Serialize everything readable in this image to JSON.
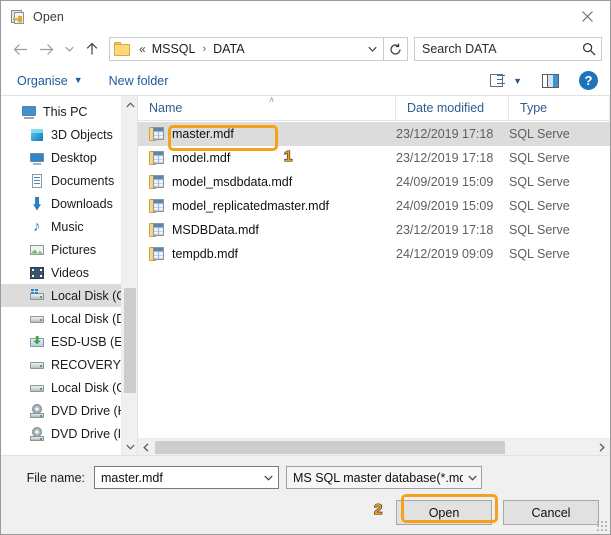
{
  "window": {
    "title": "Open",
    "title_icon": "database-file-icon",
    "close_label": "close-icon"
  },
  "nav": {
    "back_icon": "arrow-left-icon",
    "forward_icon": "arrow-right-icon",
    "recent_icon": "chevron-down-icon",
    "up_icon": "arrow-up-icon",
    "breadcrumb": {
      "folder_icon": "folder-icon",
      "overflow": "«",
      "items": [
        "MSSQL",
        "DATA"
      ],
      "separator": "›",
      "dropdown_icon": "chevron-down-icon"
    },
    "refresh_icon": "refresh-icon",
    "search": {
      "placeholder": "Search DATA",
      "value": "",
      "icon": "search-icon"
    }
  },
  "commandbar": {
    "organise_label": "Organise",
    "organise_caret": "▼",
    "new_folder_label": "New folder",
    "view_icon": "list-view-icon",
    "view_caret": "▼",
    "preview_pane_icon": "preview-pane-icon",
    "help_label": "?"
  },
  "sidebar": {
    "items": [
      {
        "label": "This PC",
        "icon": "this-pc-icon",
        "indent": false,
        "selected": false
      },
      {
        "label": "3D Objects",
        "icon": "3d-objects-icon",
        "indent": true,
        "selected": false
      },
      {
        "label": "Desktop",
        "icon": "desktop-icon",
        "indent": true,
        "selected": false
      },
      {
        "label": "Documents",
        "icon": "documents-icon",
        "indent": true,
        "selected": false
      },
      {
        "label": "Downloads",
        "icon": "downloads-icon",
        "indent": true,
        "selected": false
      },
      {
        "label": "Music",
        "icon": "music-icon",
        "indent": true,
        "selected": false
      },
      {
        "label": "Pictures",
        "icon": "pictures-icon",
        "indent": true,
        "selected": false
      },
      {
        "label": "Videos",
        "icon": "videos-icon",
        "indent": true,
        "selected": false
      },
      {
        "label": "Local Disk (C:)",
        "icon": "windows-drive-icon",
        "indent": true,
        "selected": true
      },
      {
        "label": "Local Disk (D:)",
        "icon": "drive-icon",
        "indent": true,
        "selected": false
      },
      {
        "label": "ESD-USB (E:)",
        "icon": "usb-drive-icon",
        "indent": true,
        "selected": false
      },
      {
        "label": "RECOVERY (F:)",
        "icon": "drive-icon",
        "indent": true,
        "selected": false
      },
      {
        "label": "Local Disk (G:)",
        "icon": "drive-icon",
        "indent": true,
        "selected": false
      },
      {
        "label": "DVD Drive (H:)",
        "icon": "dvd-drive-icon",
        "indent": true,
        "selected": false
      },
      {
        "label": "DVD Drive (I:)",
        "icon": "dvd-drive-icon",
        "indent": true,
        "selected": false
      }
    ],
    "scroll_up_icon": "chevron-up-icon",
    "scroll_down_icon": "chevron-down-icon"
  },
  "filelist": {
    "columns": [
      "Name",
      "Date modified",
      "Type"
    ],
    "sort_indicator": "˄",
    "rows": [
      {
        "name": "master.mdf",
        "date": "23/12/2019 17:18",
        "type": "SQL Serve",
        "icon": "mdf-file-icon",
        "selected": true
      },
      {
        "name": "model.mdf",
        "date": "23/12/2019 17:18",
        "type": "SQL Serve",
        "icon": "mdf-file-icon",
        "selected": false
      },
      {
        "name": "model_msdbdata.mdf",
        "date": "24/09/2019 15:09",
        "type": "SQL Serve",
        "icon": "mdf-file-icon",
        "selected": false
      },
      {
        "name": "model_replicatedmaster.mdf",
        "date": "24/09/2019 15:09",
        "type": "SQL Serve",
        "icon": "mdf-file-icon",
        "selected": false
      },
      {
        "name": "MSDBData.mdf",
        "date": "23/12/2019 17:18",
        "type": "SQL Serve",
        "icon": "mdf-file-icon",
        "selected": false
      },
      {
        "name": "tempdb.mdf",
        "date": "24/12/2019 09:09",
        "type": "SQL Serve",
        "icon": "mdf-file-icon",
        "selected": false
      }
    ],
    "hscroll_left_icon": "chevron-left-icon",
    "hscroll_right_icon": "chevron-right-icon"
  },
  "footer": {
    "filename_label": "File name:",
    "filename_value": "master.mdf",
    "filename_chevron": "chevron-down-icon",
    "filter_value": "MS SQL master database(*.mdf",
    "filter_chevron": "chevron-down-icon",
    "open_label": "Open",
    "cancel_label": "Cancel"
  },
  "annotations": {
    "markers": [
      {
        "number": "1",
        "target": "master-mdf-row"
      },
      {
        "number": "2",
        "target": "open-button"
      }
    ],
    "highlight_color": "#f5a11b"
  }
}
